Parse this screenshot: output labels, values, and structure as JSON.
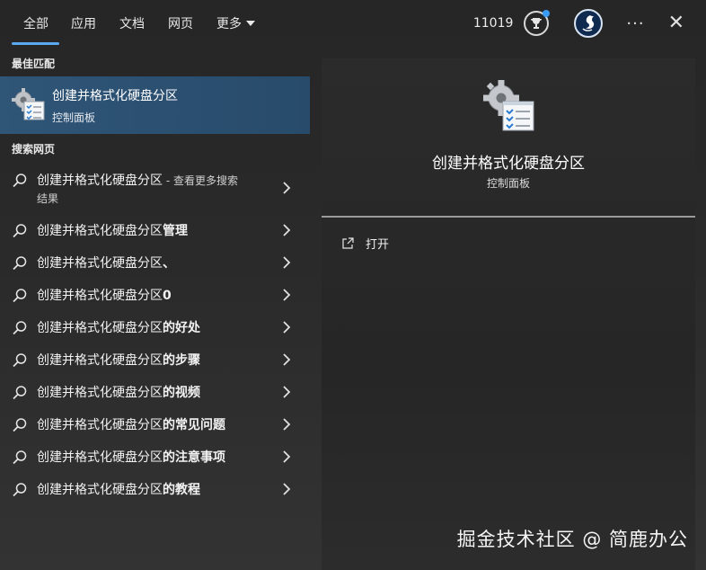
{
  "nav": {
    "tabs": [
      {
        "label": "全部",
        "active": true
      },
      {
        "label": "应用",
        "active": false
      },
      {
        "label": "文档",
        "active": false
      },
      {
        "label": "网页",
        "active": false
      },
      {
        "label": "更多",
        "active": false
      }
    ],
    "points": "11019"
  },
  "best_match": {
    "section_title": "最佳匹配",
    "title": "创建并格式化硬盘分区",
    "subtitle": "控制面板",
    "icon": "control-panel-icon"
  },
  "web_search": {
    "section_title": "搜索网页",
    "items": [
      {
        "prefix": "创建并格式化硬盘分区",
        "suffix": "",
        "hint": " - 查看更多搜索",
        "line2": "结果"
      },
      {
        "prefix": "创建并格式化硬盘分区",
        "suffix": "管理",
        "hint": "",
        "line2": ""
      },
      {
        "prefix": "创建并格式化硬盘分区",
        "suffix": "、",
        "hint": "",
        "line2": ""
      },
      {
        "prefix": "创建并格式化硬盘分区",
        "suffix": "0",
        "hint": "",
        "line2": ""
      },
      {
        "prefix": "创建并格式化硬盘分区",
        "suffix": "的好处",
        "hint": "",
        "line2": ""
      },
      {
        "prefix": "创建并格式化硬盘分区",
        "suffix": "的步骤",
        "hint": "",
        "line2": ""
      },
      {
        "prefix": "创建并格式化硬盘分区",
        "suffix": "的视频",
        "hint": "",
        "line2": ""
      },
      {
        "prefix": "创建并格式化硬盘分区",
        "suffix": "的常见问题",
        "hint": "",
        "line2": ""
      },
      {
        "prefix": "创建并格式化硬盘分区",
        "suffix": "的注意事项",
        "hint": "",
        "line2": ""
      },
      {
        "prefix": "创建并格式化硬盘分区",
        "suffix": "的教程",
        "hint": "",
        "line2": ""
      }
    ]
  },
  "detail": {
    "title": "创建并格式化硬盘分区",
    "subtitle": "控制面板",
    "open_label": "打开"
  },
  "watermark": "掘金技术社区 @ 简鹿办公",
  "colors": {
    "accent": "#5aa9f0",
    "selected_bg": "#2f5577",
    "badge": "#3b9cf6"
  }
}
